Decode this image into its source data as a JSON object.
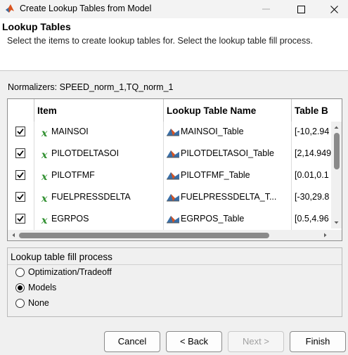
{
  "window": {
    "title": "Create Lookup Tables from Model"
  },
  "header": {
    "title": "Lookup Tables",
    "description": "Select the items to create lookup tables for. Select the lookup table fill process."
  },
  "normalizers": "Normalizers: SPEED_norm_1,TQ_norm_1",
  "table": {
    "columns": [
      "Item",
      "Lookup Table Name",
      "Table B"
    ],
    "rows": [
      {
        "checked": true,
        "item": "MAINSOI",
        "table_name": "MAINSOI_Table",
        "breakpoints": "[-10,2.94"
      },
      {
        "checked": true,
        "item": "PILOTDELTASOI",
        "table_name": "PILOTDELTASOI_Table",
        "breakpoints": "[2,14.949"
      },
      {
        "checked": true,
        "item": "PILOTFMF",
        "table_name": "PILOTFMF_Table",
        "breakpoints": "[0.01,0.1"
      },
      {
        "checked": true,
        "item": "FUELPRESSDELTA",
        "table_name": "FUELPRESSDELTA_T...",
        "breakpoints": "[-30,29.8"
      },
      {
        "checked": true,
        "item": "EGRPOS",
        "table_name": "EGRPOS_Table",
        "breakpoints": "[0.5,4.96"
      }
    ]
  },
  "fill_process": {
    "title": "Lookup table fill process",
    "options": [
      "Optimization/Tradeoff",
      "Models",
      "None"
    ],
    "selected": "Models"
  },
  "buttons": {
    "cancel": "Cancel",
    "back": "< Back",
    "next": "Next >",
    "finish": "Finish"
  },
  "colors": {
    "accent_green": "#2f8f2f",
    "matlab_orange": "#d9531e"
  },
  "icons": {
    "item": "x-variable-icon",
    "table": "lookup-table-icon"
  }
}
